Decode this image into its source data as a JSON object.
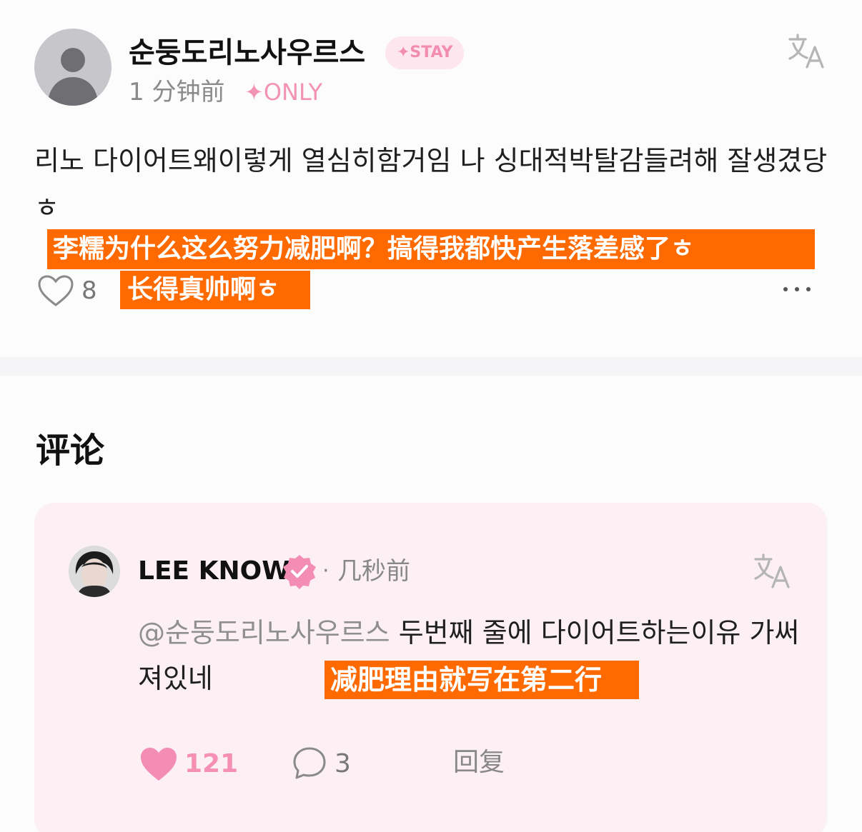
{
  "post": {
    "author": "순둥도리노사우르스",
    "badge": "✦STAY",
    "time": "1 分钟前",
    "only_tag": "✦ONLY",
    "body": "리노 다이어트왜이렇게 열심히함거임 나 싱대적박탈감들려해 잘생겼당ㅎ",
    "translation_line1": "李糯为什么这么努力减肥啊？搞得我都快产生落差感了ㅎ",
    "translation_line2": "长得真帅啊ㅎ",
    "likes": "8"
  },
  "comments": {
    "title": "评论",
    "items": [
      {
        "author": "LEE KNOW",
        "separator": "·",
        "time": "几秒前",
        "mention": "@순둥도리노사우르스",
        "text": " 두번째 줄에 다이어트하는이유 가써져있네",
        "translation": "减肥理由就写在第二行",
        "likes": "121",
        "replies": "3",
        "reply_label": "回复"
      }
    ]
  },
  "colors": {
    "accent_pink": "#f28cb1",
    "highlight_orange": "#ff6a00",
    "comment_card_bg": "#fdf0f5"
  },
  "icons": {
    "translate": "translate-icon",
    "like": "heart-icon",
    "reply": "speech-bubble-icon",
    "more": "more-dots-icon",
    "verified": "verified-badge-icon"
  }
}
